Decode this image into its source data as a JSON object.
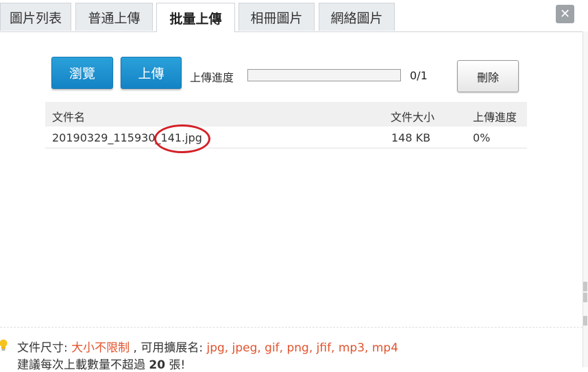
{
  "tabs": [
    {
      "label": "圖片列表",
      "active": false
    },
    {
      "label": "普通上傳",
      "active": false
    },
    {
      "label": "批量上傳",
      "active": true
    },
    {
      "label": "相冊圖片",
      "active": false
    },
    {
      "label": "網絡圖片",
      "active": false
    }
  ],
  "toolbar": {
    "browse_label": "瀏覽",
    "upload_label": "上傳",
    "progress_label": "上傳進度",
    "progress_count": "0/1",
    "progress_value": 0,
    "delete_label": "刪除"
  },
  "table": {
    "columns": [
      "文件名",
      "文件大小",
      "上傳進度"
    ],
    "rows": [
      {
        "name": "20190329_115930_141.jpg",
        "size": "148 KB",
        "progress": "0%"
      }
    ]
  },
  "hint": {
    "size_label": "文件尺寸: ",
    "size_value": "大小不限制",
    "ext_label": " , 可用擴展名: ",
    "ext_value": "jpg, jpeg, gif, png, jfif, mp3, mp4",
    "count_prefix": "建議每次上載數量不超過 ",
    "count_value": "20",
    "count_suffix": " 張!"
  },
  "colors": {
    "accent": "#1483c5",
    "highlight": "#e0532d",
    "annotation": "#d42027"
  },
  "icons": {
    "close": "close-icon",
    "hint": "lightbulb-icon"
  }
}
